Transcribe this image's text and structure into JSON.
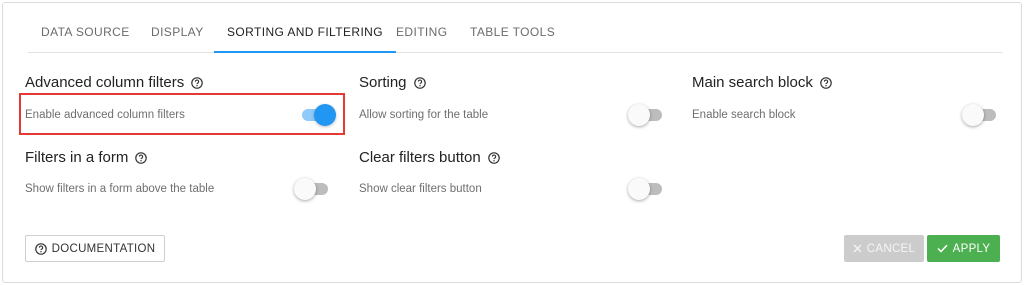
{
  "tabs": [
    {
      "label": "DATA SOURCE"
    },
    {
      "label": "DISPLAY"
    },
    {
      "label": "SORTING AND FILTERING",
      "active": true
    },
    {
      "label": "EDITING"
    },
    {
      "label": "TABLE TOOLS"
    }
  ],
  "settings": {
    "advanced_filters": {
      "title": "Advanced column filters",
      "description": "Enable advanced column filters",
      "enabled": true
    },
    "sorting": {
      "title": "Sorting",
      "description": "Allow sorting for the table",
      "enabled": false
    },
    "main_search": {
      "title": "Main search block",
      "description": "Enable search block",
      "enabled": false
    },
    "filters_form": {
      "title": "Filters in a form",
      "description": "Show filters in a form above the table",
      "enabled": false
    },
    "clear_filters": {
      "title": "Clear filters button",
      "description": "Show clear filters button",
      "enabled": false
    }
  },
  "footer": {
    "documentation_label": "DOCUMENTATION",
    "cancel_label": "CANCEL",
    "apply_label": "APPLY"
  },
  "colors": {
    "accent": "#2196f3",
    "apply": "#4caf50",
    "cancel_disabled": "#cccccc",
    "highlight": "#e53935"
  },
  "icons": {
    "help": "question-circle-icon",
    "cancel": "close-icon",
    "apply": "check-icon"
  }
}
